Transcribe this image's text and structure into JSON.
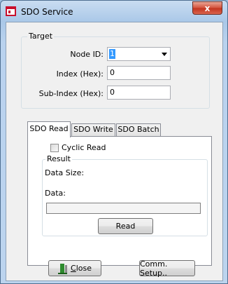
{
  "window": {
    "title": "SDO Service",
    "close_glyph": "x"
  },
  "target": {
    "legend": "Target",
    "node_id_label": "Node ID:",
    "node_id_value": "1",
    "index_label": "Index (Hex):",
    "index_value": "0",
    "subindex_label": "Sub-Index (Hex):",
    "subindex_value": "0"
  },
  "tabs": [
    {
      "label": "SDO Read",
      "active": true
    },
    {
      "label": "SDO Write",
      "active": false
    },
    {
      "label": "SDO Batch",
      "active": false
    }
  ],
  "sdo_read": {
    "cyclic_label": "Cyclic Read",
    "cyclic_checked": false,
    "result_legend": "Result",
    "data_size_label": "Data Size:",
    "data_label": "Data:",
    "read_button": "Read"
  },
  "footer": {
    "close_button_first": "C",
    "close_button_rest": "lose",
    "comm_setup_button": "Comm. Setup.."
  },
  "colors": {
    "selection": "#3399ff",
    "close_red": "#c2331e",
    "close_icon_green": "#2e8b2e"
  }
}
